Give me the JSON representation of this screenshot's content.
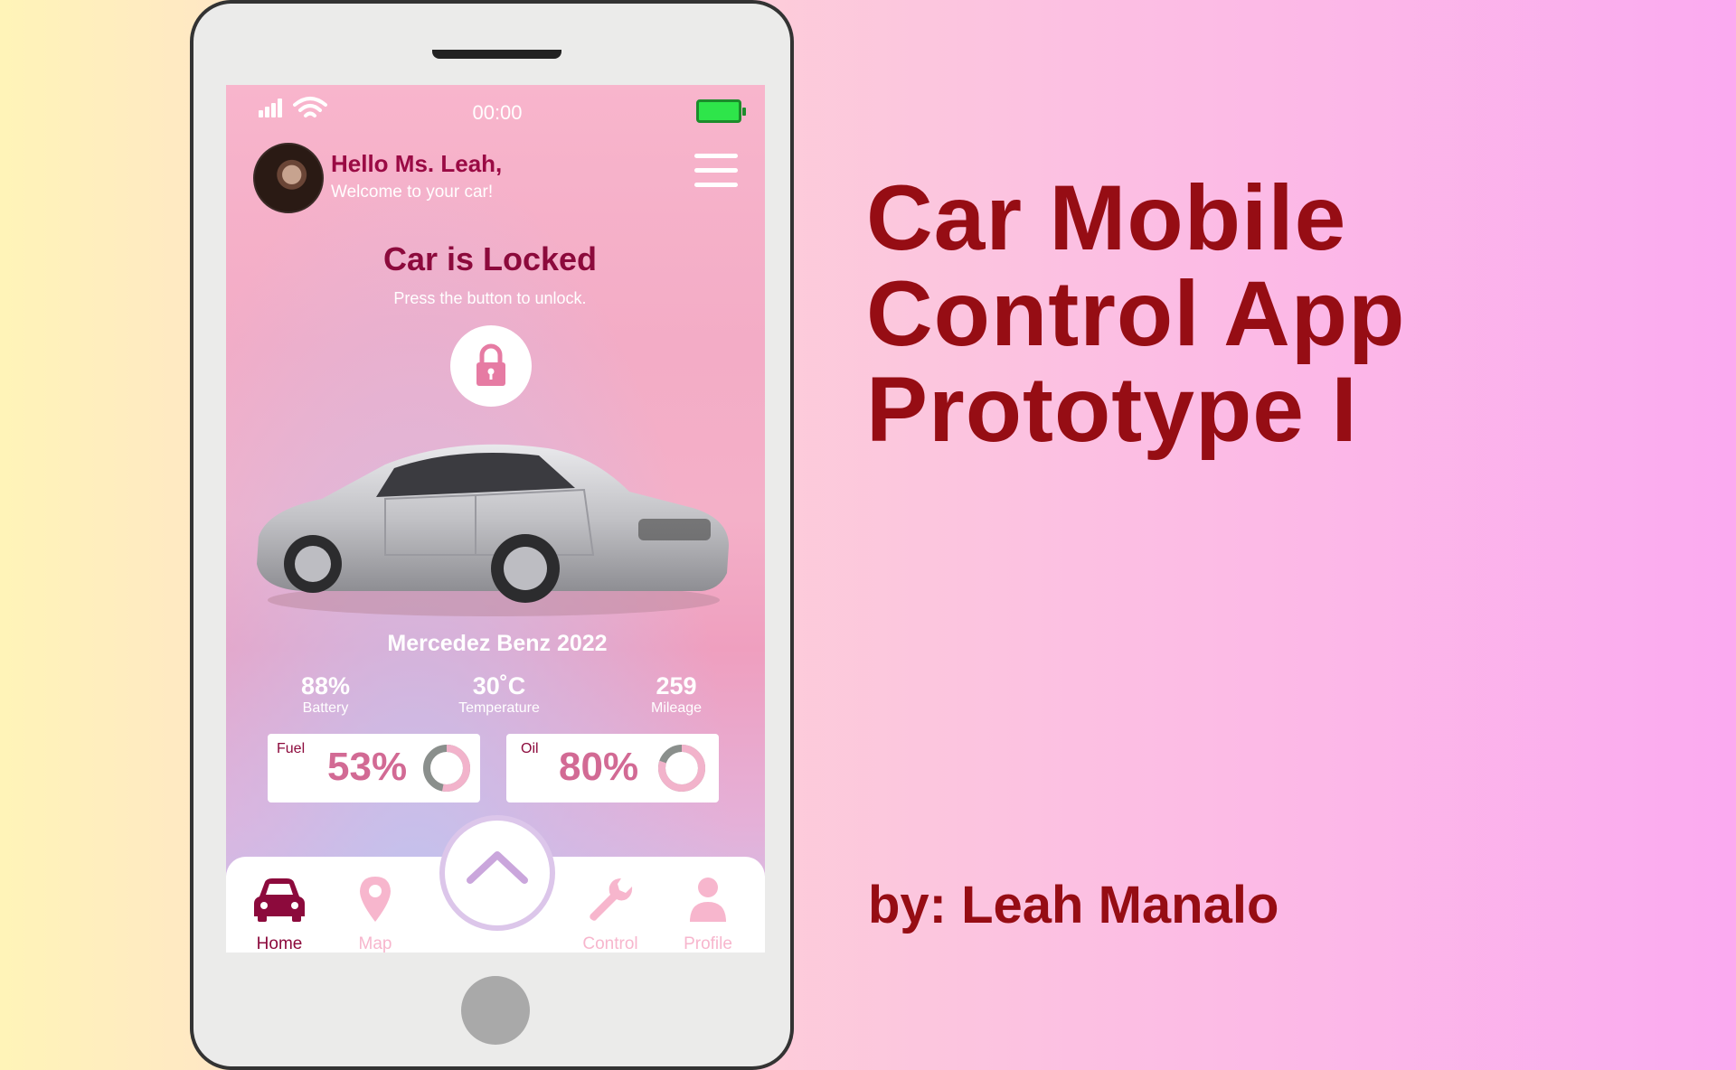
{
  "status_bar": {
    "time": "00:00"
  },
  "greeting": {
    "title": "Hello Ms. Leah,",
    "subtitle": "Welcome to your car!"
  },
  "lock": {
    "title": "Car is Locked",
    "subtitle": "Press the button to unlock."
  },
  "car": {
    "name": "Mercedez Benz 2022"
  },
  "stats": [
    {
      "value": "88%",
      "label": "Battery"
    },
    {
      "value": "30˚C",
      "label": "Temperature"
    },
    {
      "value": "259",
      "label": "Mileage"
    }
  ],
  "gauges": [
    {
      "label": "Fuel",
      "value": "53%",
      "fraction": 0.53
    },
    {
      "label": "Oil",
      "value": "80%",
      "fraction": 0.8
    }
  ],
  "nav": [
    {
      "label": "Home",
      "icon": "car-icon",
      "active": true
    },
    {
      "label": "Map",
      "icon": "map-pin-icon",
      "active": false
    },
    {
      "label": "Control",
      "icon": "wrench-icon",
      "active": false
    },
    {
      "label": "Profile",
      "icon": "person-icon",
      "active": false
    }
  ],
  "colors": {
    "accent": "#8c0a3c",
    "gauge_text": "#d26a94",
    "nav_inactive": "#f7b6cd",
    "battery": "#2ee54a",
    "headline": "#960d14"
  },
  "headline": {
    "line1": "Car Mobile",
    "line2": "Control App",
    "line3": "Prototype I"
  },
  "author": "by: Leah Manalo"
}
